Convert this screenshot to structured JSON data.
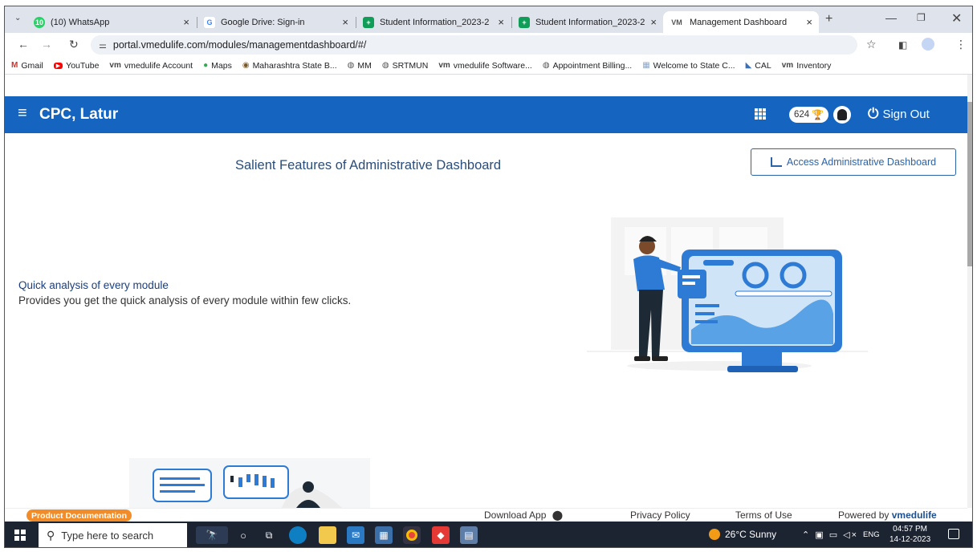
{
  "browser": {
    "tabs": [
      {
        "title": "(10) WhatsApp",
        "icon": "whatsapp-icon",
        "color": "#25d366",
        "badge": "10",
        "active": false
      },
      {
        "title": "Google Drive: Sign-in",
        "icon": "google-icon",
        "color": "#4285f4",
        "badge": "G",
        "active": false
      },
      {
        "title": "Student Information_2023-2",
        "icon": "sheets-icon",
        "color": "#0f9d58",
        "badge": "+",
        "active": false
      },
      {
        "title": "Student Information_2023-2",
        "icon": "sheets-icon",
        "color": "#0f9d58",
        "badge": "+",
        "active": false
      },
      {
        "title": "Management Dashboard",
        "icon": "vmedulife-icon",
        "color": "#555555",
        "badge": "vm",
        "active": true
      }
    ],
    "new_tab": "+",
    "url": "portal.vmedulife.com/modules/managementdashboard/#/",
    "bookmarks": [
      {
        "label": "Gmail",
        "icon": "gmail-icon",
        "glyph": "M",
        "color": "#d93025"
      },
      {
        "label": "YouTube",
        "icon": "youtube-icon",
        "glyph": "▶",
        "color": "#ff0000"
      },
      {
        "label": "vmedulife Account",
        "icon": "vmedulife-icon",
        "glyph": "vm",
        "color": "#444444"
      },
      {
        "label": "Maps",
        "icon": "maps-icon",
        "glyph": "●",
        "color": "#34a853"
      },
      {
        "label": "Maharashtra State B...",
        "icon": "seal-icon",
        "glyph": "◉",
        "color": "#7a5a2a"
      },
      {
        "label": "MM",
        "icon": "globe-icon",
        "glyph": "◍",
        "color": "#555555"
      },
      {
        "label": "SRTMUN",
        "icon": "globe-icon",
        "glyph": "◍",
        "color": "#555555"
      },
      {
        "label": "vmedulife Software...",
        "icon": "vmedulife-icon",
        "glyph": "vm",
        "color": "#444444"
      },
      {
        "label": "Appointment Billing...",
        "icon": "globe-icon",
        "glyph": "◍",
        "color": "#555555"
      },
      {
        "label": "Welcome to State C...",
        "icon": "building-icon",
        "glyph": "▦",
        "color": "#8ea9c8"
      },
      {
        "label": "CAL",
        "icon": "cal-icon",
        "glyph": "◣",
        "color": "#3b6fb6"
      },
      {
        "label": "Inventory",
        "icon": "vmedulife-icon",
        "glyph": "vm",
        "color": "#444444"
      }
    ]
  },
  "app": {
    "brand": "CPC, Latur",
    "points": "624",
    "signout": "Sign Out",
    "header_color": "#1565c0"
  },
  "main": {
    "heading": "Salient Features of Administrative Dashboard",
    "access_button": "Access Administrative Dashboard",
    "feature_title": "Quick analysis of every module",
    "feature_desc": "Provides you get the quick analysis of every module within few clicks."
  },
  "footer": {
    "doc_badge": "Product Documentation",
    "download": "Download App",
    "privacy": "Privacy Policy",
    "terms": "Terms of Use",
    "powered_prefix": "Powered by",
    "powered_brand": "vmedulife"
  },
  "taskbar": {
    "search_placeholder": "Type here to search",
    "weather": "26°C  Sunny",
    "lang": "ENG",
    "time": "04:57 PM",
    "date": "14-12-2023"
  }
}
